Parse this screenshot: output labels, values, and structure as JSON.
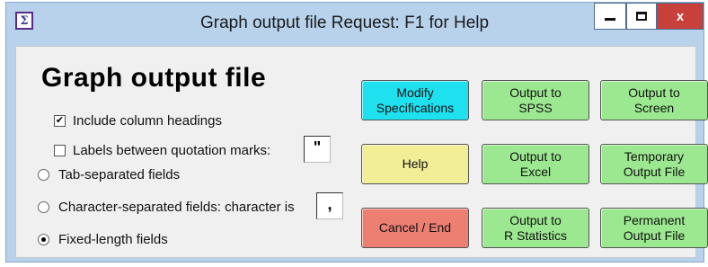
{
  "window": {
    "title": "Graph output file Request: F1 for Help",
    "app_icon_glyph": "Σ",
    "close_glyph": "x"
  },
  "heading": "Graph output  file",
  "options": {
    "include_headings": {
      "label": "Include column headings",
      "checked": true
    },
    "quote_labels": {
      "label": "Labels between quotation marks:",
      "checked": false,
      "char": "\""
    },
    "tab_separated": {
      "label": "Tab-separated fields",
      "selected": false
    },
    "char_separated": {
      "label": "Character-separated fields: character is",
      "selected": false,
      "char": ","
    },
    "fixed_length": {
      "label": "Fixed-length fields",
      "selected": true
    }
  },
  "buttons": {
    "modify": "Modify\nSpecifications",
    "spss": "Output to\nSPSS",
    "screen": "Output to\nScreen",
    "help": "Help",
    "excel": "Output to\nExcel",
    "temporary": "Temporary\nOutput File",
    "cancel": "Cancel / End",
    "r_stats": "Output to\nR Statistics",
    "permanent": "Permanent\nOutput File"
  },
  "colors": {
    "modify": "#1ee0ee",
    "output": "#9ce890",
    "help": "#f2ee98",
    "cancel": "#ec7e72",
    "close": "#c8403a"
  }
}
